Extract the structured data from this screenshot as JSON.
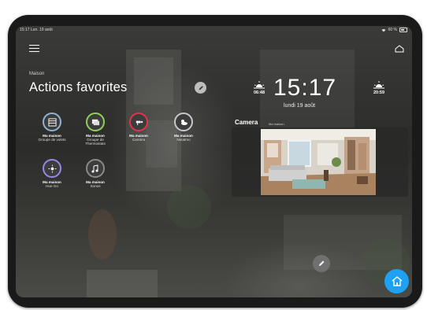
{
  "status": {
    "time": "15:17",
    "date": "Lun. 19 août",
    "battery": "60 %"
  },
  "header": {
    "section": "Maison",
    "title": "Actions favorites"
  },
  "favorites": [
    {
      "home": "Ma maison",
      "name": "Groupe de volets",
      "icon": "shutters-icon",
      "color": "#8fb3d6"
    },
    {
      "home": "Ma maison",
      "name": "Groupe de Thermostats",
      "icon": "thermostat-icon",
      "color": "#8fcf5a"
    },
    {
      "home": "Ma maison",
      "name": "Caméra",
      "icon": "camera-icon",
      "color": "#e0344c"
    },
    {
      "home": "Ma maison",
      "name": "Netatmo",
      "icon": "weather-icon",
      "color": "#c8c8c8"
    },
    {
      "home": "Ma maison",
      "name": "Hue Go",
      "icon": "light-icon",
      "color": "#9a86e8"
    },
    {
      "home": "Ma maison",
      "name": "Sonos",
      "icon": "music-icon",
      "color": "#8a8a8a"
    }
  ],
  "clock": {
    "time": "15:17",
    "date": "lundi 19 août",
    "sunrise": "06:48",
    "sunset": "20:59"
  },
  "camera": {
    "title": "Camera",
    "subtitle": "Ma maison"
  },
  "colors": {
    "accent": "#1da1f2"
  }
}
